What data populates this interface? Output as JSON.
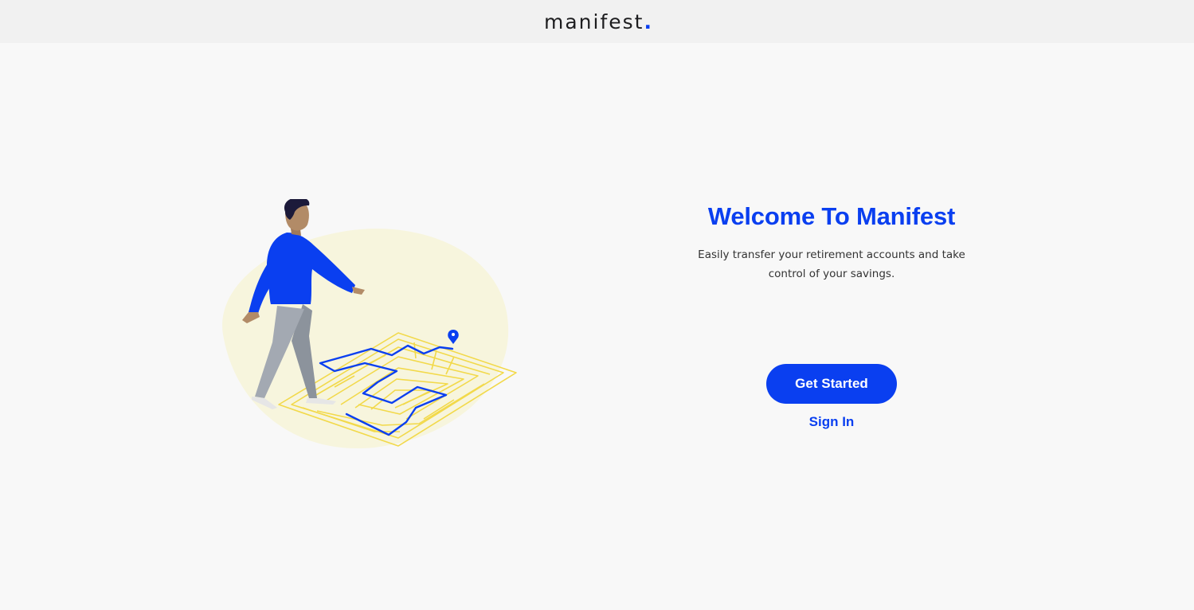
{
  "header": {
    "logo_text": "manifest",
    "logo_dot": ".",
    "logo_accent_color": "#0a3ff0"
  },
  "illustration": {
    "icon": "person-walking-maze-illustration",
    "colors": {
      "blob": "#f7f5dd",
      "maze": "#f2d94a",
      "path": "#0a3ff0",
      "sweater": "#0a3ff0",
      "pants": "#9ea5af",
      "skin": "#b28b67",
      "hair": "#1c1a3a"
    }
  },
  "welcome": {
    "title": "Welcome To Manifest",
    "subtitle": "Easily transfer your retirement accounts and take control of your savings."
  },
  "actions": {
    "get_started_label": "Get Started",
    "sign_in_label": "Sign In"
  },
  "colors": {
    "accent": "#0a3ff0",
    "background": "#f8f8f8",
    "topbar": "#f1f1f1"
  }
}
